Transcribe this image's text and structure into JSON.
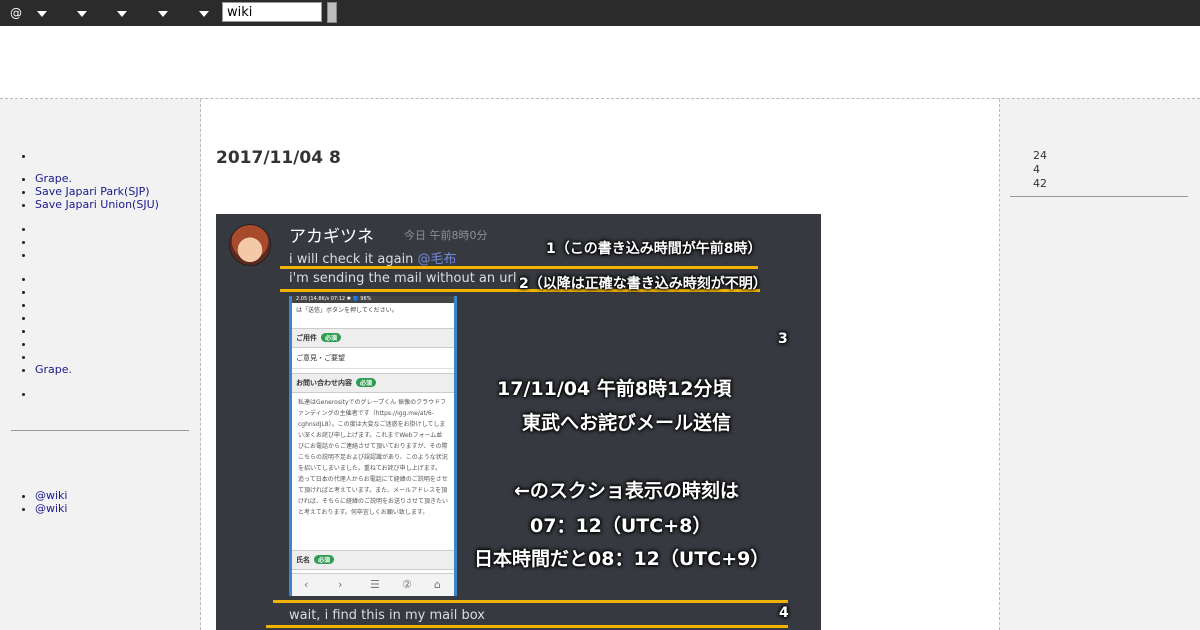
{
  "toolbar": {
    "at_label": "@",
    "search_value": "wiki"
  },
  "sidebar": {
    "links_a": [
      "Grape.",
      "Save Japari Park(SJP)",
      "Save Japari Union(SJU)"
    ],
    "link_b": "Grape.",
    "footer_links": [
      "@wiki",
      "@wiki"
    ]
  },
  "main": {
    "title": "2017/11/04 8"
  },
  "right": {
    "stats": [
      "24",
      "4",
      "42"
    ]
  },
  "screenshot": {
    "username": "アカギツネ",
    "timestamp": "今日 午前8時0分",
    "msg1_text": "i will check it again ",
    "msg1_mention": "@毛布",
    "msg2": "i'm sending the mail without an url",
    "msg3": "wait, i find this in my mail box",
    "ann1": "1（この書き込み時間が午前8時）",
    "ann2": "2（以降は正確な書き込み時刻が不明）",
    "ann3": "3",
    "ann4": "4",
    "center_lines": [
      "17/11/04 午前8時12分頃",
      "東武へお詫びメール送信",
      "←のスクショ表示の時刻は",
      "07：12（UTC+8）",
      "日本時間だと08：12（UTC+9）"
    ],
    "phone": {
      "status": "2.05 |14.8K/s          07:12          ✱ 🔵 96%",
      "intro": "は「送信」ボタンを押してください。",
      "sect1": "ご用件",
      "required": "必須",
      "field1": "ご意見・ご要望",
      "sect2": "お問い合わせ内容",
      "body": "私達はGenerosityでのグレープくん 振像のクラウドファンディングの主催者です（https://igg.me/at/6-cghnsdJL8）。この度は大変なご迷惑をお掛けしてしまい深くお詫び申し上げます。これまでWebフォーム並びにお電話からご連絡させて頂いておりますが、その際こちらの説明不足および誤認識があり、このような状況を招いてしまいました。重ねてお詫び申し上げます。 追って日本の代理人からお電話にて経緯のご説明をさせて頂ければと考えています。また、メールアドレスを頂ければ、そちらに経緯のご説明をお送りさせて頂きたいと考えております。何卒宜しくお願い致します。",
      "sect3": "氏名",
      "nav": [
        "‹",
        "›",
        "☰",
        "②",
        "⌂"
      ]
    }
  }
}
